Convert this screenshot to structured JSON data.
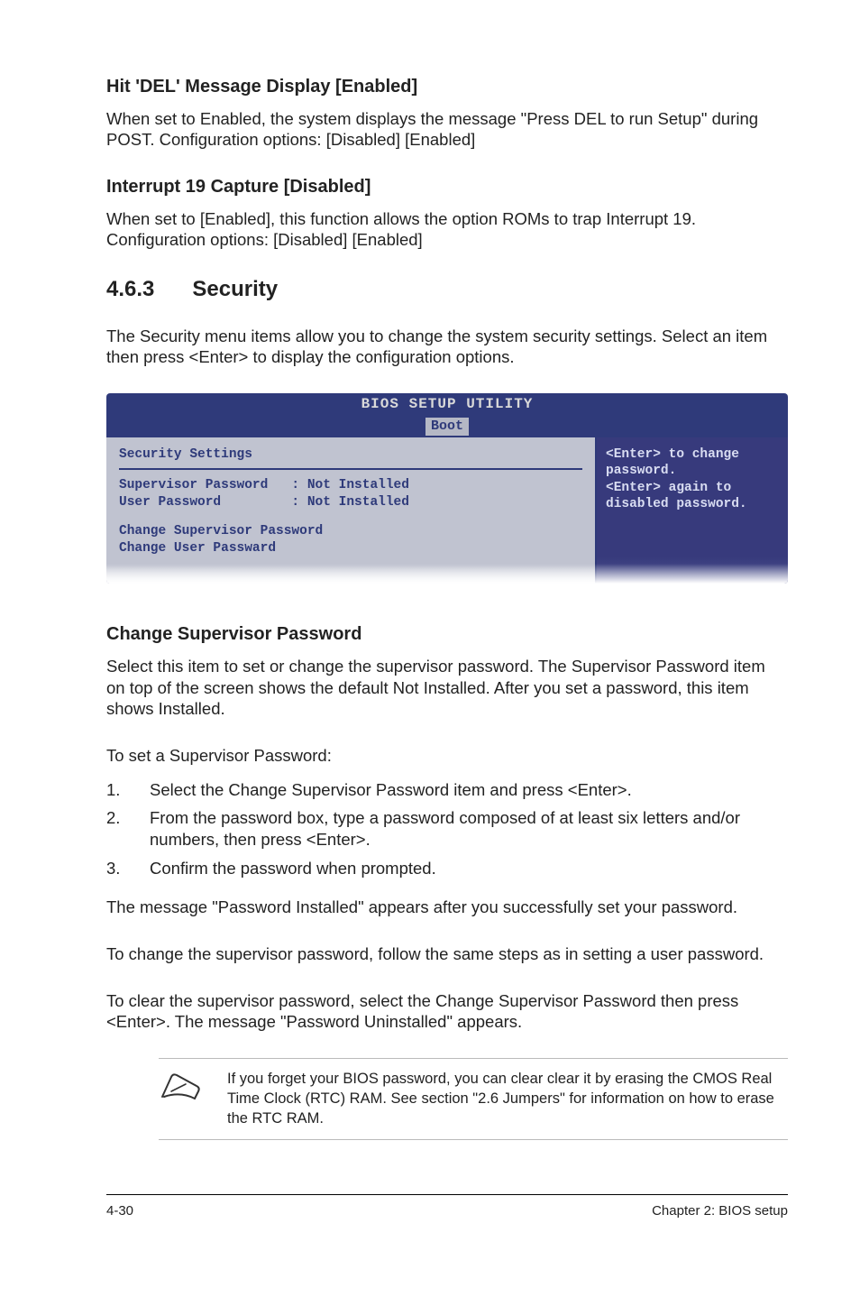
{
  "s1": {
    "heading": "Hit 'DEL' Message Display [Enabled]",
    "body": "When set to Enabled, the system displays the message \"Press DEL to run Setup\" during POST. Configuration options: [Disabled] [Enabled]"
  },
  "s2": {
    "heading": "Interrupt 19 Capture [Disabled]",
    "body": "When set to [Enabled], this function allows the option ROMs to trap Interrupt 19. Configuration options: [Disabled] [Enabled]"
  },
  "sec463": {
    "num": "4.6.3",
    "title": "Security",
    "intro": "The Security menu items allow you to change the system security settings. Select an item then press <Enter> to display the configuration options."
  },
  "bios": {
    "title": "BIOS SETUP UTILITY",
    "tab": "Boot",
    "sec_head": "Security Settings",
    "row1": "Supervisor Password   : Not Installed",
    "row2": "User Password         : Not Installed",
    "row3": "Change Supervisor Password",
    "row4": "Change User Passward",
    "help1": "<Enter> to change",
    "help2": "password.",
    "help3": "<Enter> again to",
    "help4": "disabled password."
  },
  "csp": {
    "heading": "Change Supervisor Password",
    "p1": "Select this item to set or change the supervisor password. The Supervisor Password item on top of the screen shows the default Not Installed. After you set a password, this item shows Installed.",
    "p2": "To set a Supervisor Password:",
    "li1": "Select the Change Supervisor Password item and press <Enter>.",
    "li2": "From the password box, type a password composed of at least six letters and/or numbers, then press <Enter>.",
    "li3": "Confirm the password when prompted.",
    "p3": "The message \"Password Installed\" appears after you successfully set your password.",
    "p4": "To change the supervisor password, follow the same steps as in setting a user password.",
    "p5": "To clear the supervisor password, select the Change Supervisor Password then press <Enter>. The message \"Password Uninstalled\" appears."
  },
  "note": "If you forget your BIOS password, you can clear clear it by erasing the CMOS Real Time Clock (RTC) RAM. See section \"2.6  Jumpers\" for information on how to erase the RTC RAM.",
  "footer": {
    "left": "4-30",
    "right": "Chapter 2: BIOS setup"
  },
  "ol_nums": {
    "n1": "1.",
    "n2": "2.",
    "n3": "3."
  }
}
